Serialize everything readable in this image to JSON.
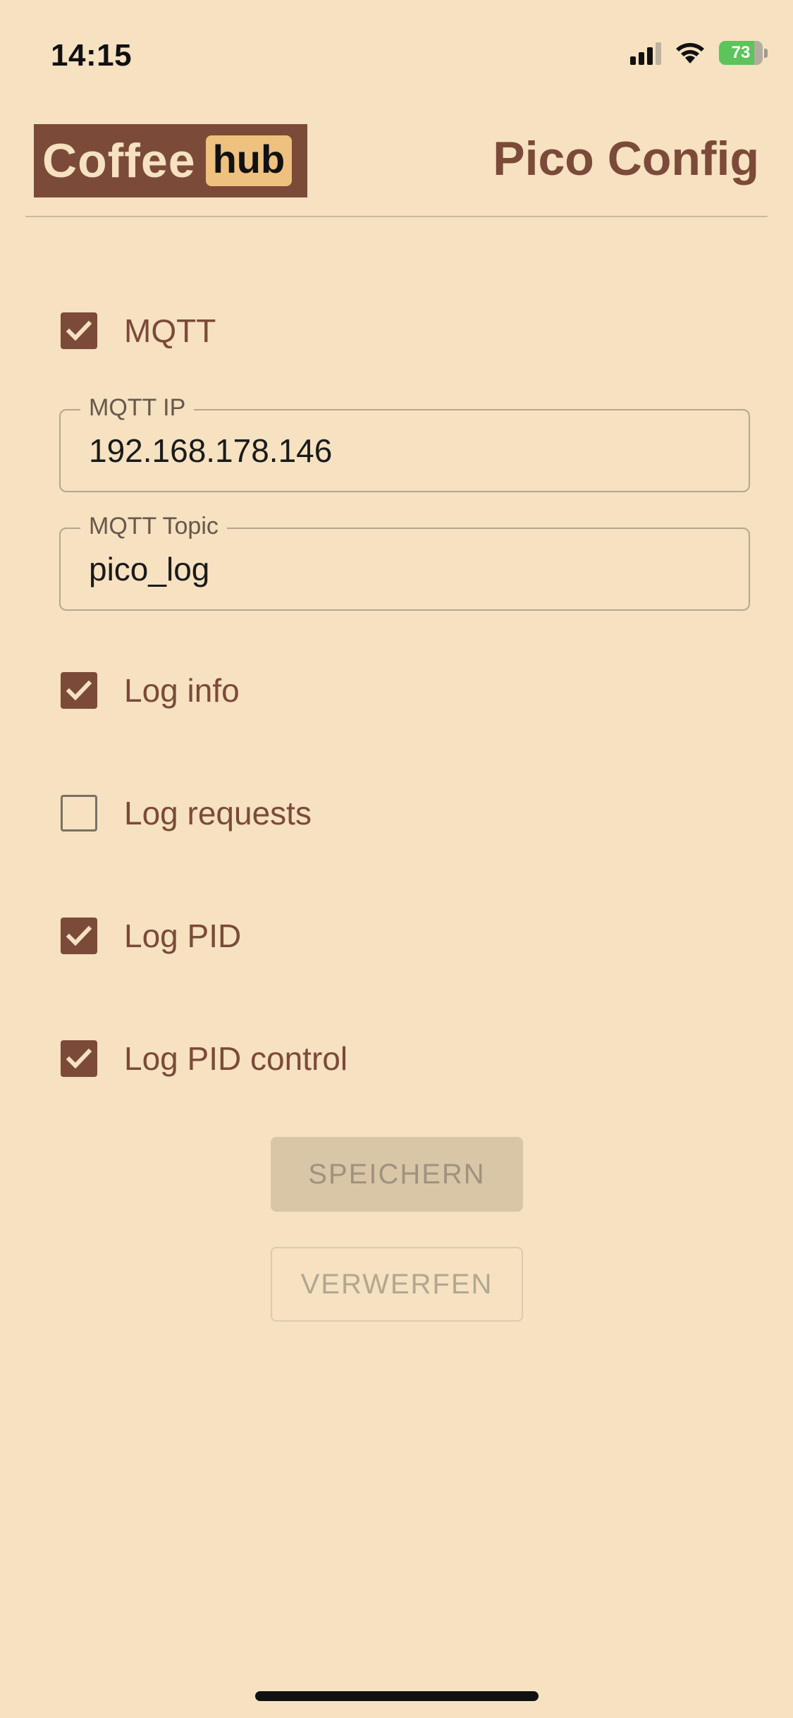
{
  "status_bar": {
    "time": "14:15",
    "battery": "73"
  },
  "header": {
    "logo_word": "Coffee",
    "logo_badge": "hub",
    "title": "Pico Config"
  },
  "form": {
    "mqtt": {
      "label": "MQTT",
      "checked": true
    },
    "mqtt_ip": {
      "label": "MQTT IP",
      "value": "192.168.178.146"
    },
    "mqtt_topic": {
      "label": "MQTT Topic",
      "value": "pico_log"
    },
    "log_info": {
      "label": "Log info",
      "checked": true
    },
    "log_requests": {
      "label": "Log requests",
      "checked": false
    },
    "log_pid": {
      "label": "Log PID",
      "checked": true
    },
    "log_pid_control": {
      "label": "Log PID control",
      "checked": true
    }
  },
  "actions": {
    "save_label": "SPEICHERN",
    "discard_label": "VERWERFEN"
  },
  "colors": {
    "background": "#f6e1c1",
    "accent": "#7b4a39",
    "badge": "#efc17e"
  }
}
